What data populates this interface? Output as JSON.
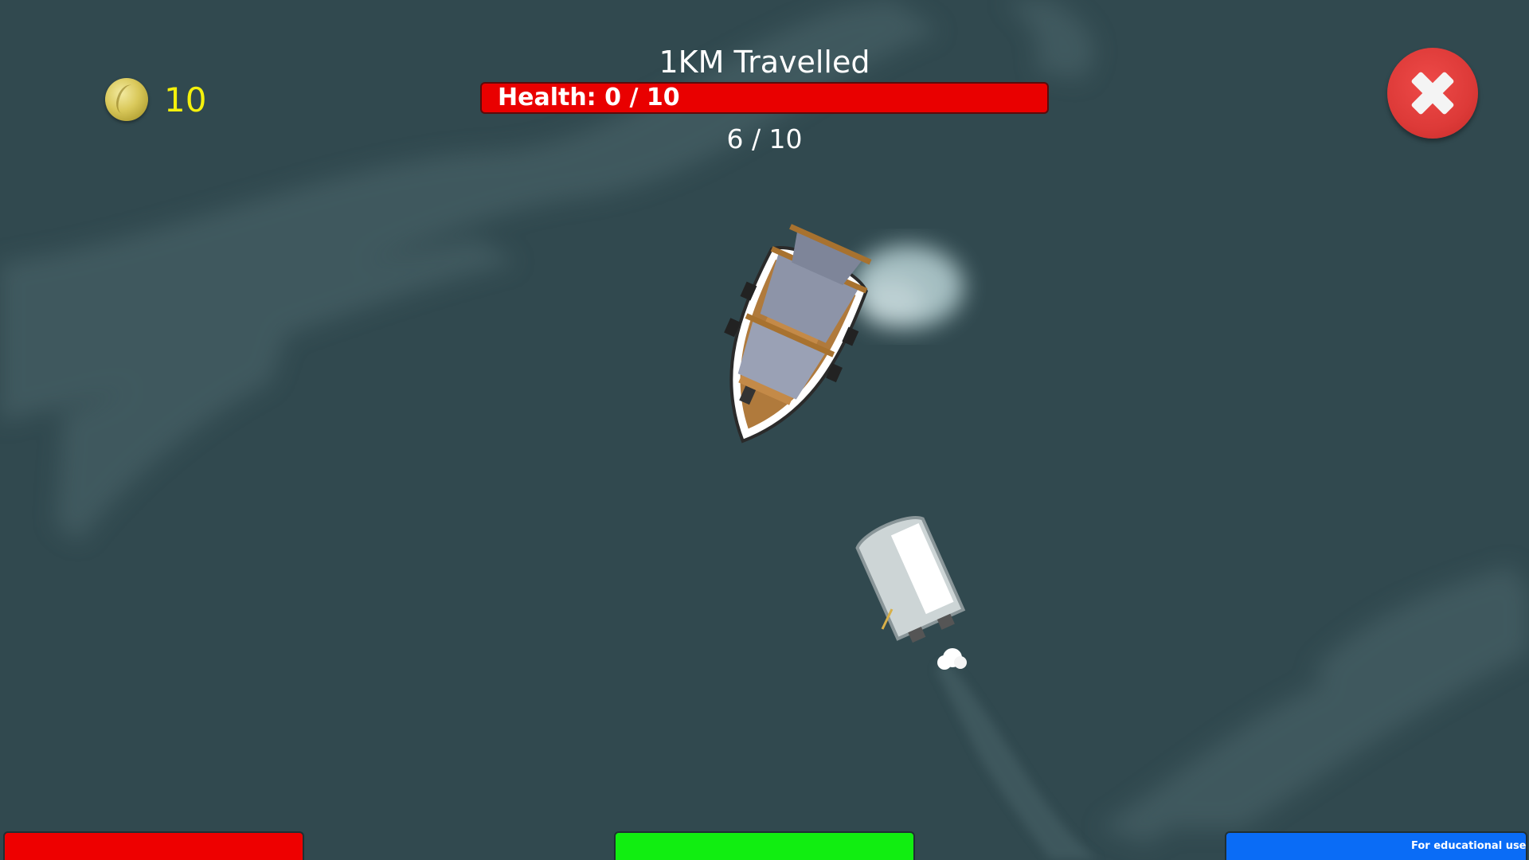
{
  "hud": {
    "coins": "10",
    "distance": "1KM Travelled",
    "health": "Health: 0 / 10",
    "ammo": "6 / 10",
    "health_fraction": 0
  },
  "buttons": {
    "close_icon": "close-x-icon",
    "left_color": "#ee0000",
    "center_color": "#11ee11",
    "right_color": "#0a6cf6"
  },
  "footer": {
    "note": "For educational use only"
  },
  "colors": {
    "sea": "#31494f",
    "coin_text": "#f5f10c",
    "health_bar": "#e90000",
    "close_button": "#dd3a38"
  }
}
